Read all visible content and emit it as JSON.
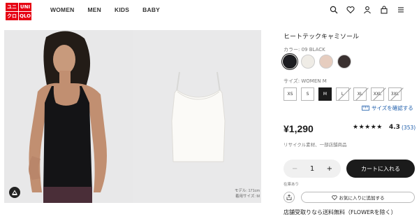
{
  "header": {
    "logo": [
      "ユニ",
      "UNI",
      "クロ",
      "QLO"
    ],
    "nav": [
      "WOMEN",
      "MEN",
      "KIDS",
      "BABY"
    ],
    "icons": [
      "search-icon",
      "heart-icon",
      "user-icon",
      "cart-icon",
      "menu-icon"
    ]
  },
  "gallery": {
    "model_info_line1": "モデル: 171cm",
    "model_info_line2": "着用サイズ: M"
  },
  "product": {
    "name": "ヒートテックキャミソール",
    "color_label": "カラー: 09 BLACK",
    "colors": [
      {
        "name": "black",
        "hex": "#1c1d21",
        "selected": true
      },
      {
        "name": "off-white",
        "hex": "#efece6",
        "selected": false
      },
      {
        "name": "beige",
        "hex": "#e6cdbf",
        "selected": false
      },
      {
        "name": "dark-brown",
        "hex": "#3a3130",
        "selected": false
      }
    ],
    "size_label": "サイズ: WOMEN M",
    "sizes": [
      {
        "label": "XS",
        "state": "available"
      },
      {
        "label": "S",
        "state": "available"
      },
      {
        "label": "M",
        "state": "selected"
      },
      {
        "label": "L",
        "state": "unavailable"
      },
      {
        "label": "XL",
        "state": "unavailable"
      },
      {
        "label": "XXL",
        "state": "unavailable"
      },
      {
        "label": "3XL",
        "state": "unavailable"
      }
    ],
    "size_guide": "サイズを確認する",
    "price": "¥1,290",
    "stars": "★★★★★",
    "rating": "4.3",
    "reviews": "(353)",
    "material": "リサイクル素材、一部店舗商品",
    "qty_minus": "−",
    "quantity": "1",
    "qty_plus": "+",
    "cart_button": "カートに入れる",
    "stock": "在庫あり",
    "favorite": "お気に入りに追加する",
    "shipping": "店舗受取りなら送料無料（FLOWERを除く）"
  }
}
